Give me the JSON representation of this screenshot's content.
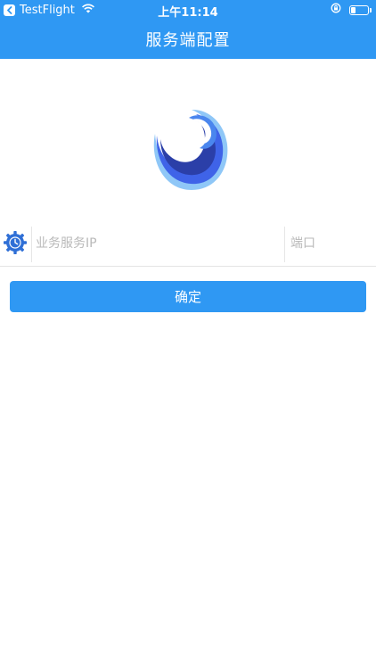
{
  "status_bar": {
    "app_label": "TestFlight",
    "time": "上午11:14",
    "battery_level": 0.3
  },
  "nav": {
    "title": "服务端配置"
  },
  "form": {
    "ip_placeholder": "业务服务IP",
    "ip_value": "",
    "port_placeholder": "端口",
    "port_value": ""
  },
  "confirm_label": "确定",
  "colors": {
    "primary": "#2f98f3",
    "logo_blue": "#3f63e8"
  },
  "icons": {
    "back": "back-chevron-icon",
    "wifi": "wifi-icon",
    "rotation_lock": "rotation-lock-icon",
    "battery": "battery-icon",
    "settings": "gear-icon",
    "logo": "wave-logo"
  }
}
